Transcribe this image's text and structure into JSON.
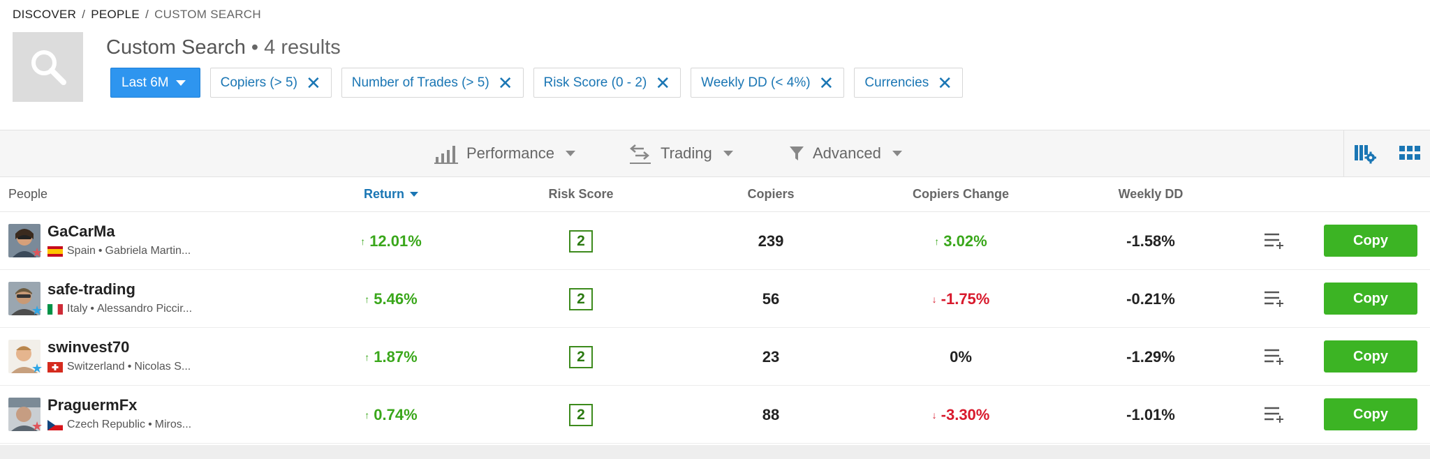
{
  "breadcrumb": {
    "items": [
      "DISCOVER",
      "PEOPLE",
      "CUSTOM SEARCH"
    ],
    "separator": "/"
  },
  "header": {
    "title": "Custom Search",
    "results": "• 4 results",
    "thumb_icon": "search-icon"
  },
  "filters": {
    "period": "Last 6M",
    "chips": [
      "Copiers (> 5)",
      "Number of Trades (> 5)",
      "Risk Score (0 - 2)",
      "Weekly DD (< 4%)",
      "Currencies"
    ],
    "remove_glyph": "✕"
  },
  "toolbar": {
    "performance": "Performance",
    "trading": "Trading",
    "advanced": "Advanced"
  },
  "table": {
    "columns": {
      "people": "People",
      "return": "Return",
      "risk": "Risk Score",
      "copiers": "Copiers",
      "change": "Copiers Change",
      "dd": "Weekly DD"
    },
    "rows": [
      {
        "username": "GaCarMa",
        "country": "Spain",
        "name": "Gabriela Martin...",
        "return": "12.01%",
        "return_dir": "up",
        "risk": "2",
        "copiers": "239",
        "change": "3.02%",
        "change_dir": "up",
        "weekly_dd": "-1.58%",
        "copy": "Copy",
        "star_color": "#e0545b"
      },
      {
        "username": "safe-trading",
        "country": "Italy",
        "name": "Alessandro Piccir...",
        "return": "5.46%",
        "return_dir": "up",
        "risk": "2",
        "copiers": "56",
        "change": "-1.75%",
        "change_dir": "down",
        "weekly_dd": "-0.21%",
        "copy": "Copy",
        "star_color": "#2ea6e6"
      },
      {
        "username": "swinvest70",
        "country": "Switzerland",
        "name": "Nicolas S...",
        "return": "1.87%",
        "return_dir": "up",
        "risk": "2",
        "copiers": "23",
        "change": "0%",
        "change_dir": "none",
        "weekly_dd": "-1.29%",
        "copy": "Copy",
        "star_color": "#2ea6e6"
      },
      {
        "username": "PraguermFx",
        "country": "Czech Republic",
        "name": "Miros...",
        "return": "0.74%",
        "return_dir": "up",
        "risk": "2",
        "copiers": "88",
        "change": "-3.30%",
        "change_dir": "down",
        "weekly_dd": "-1.01%",
        "copy": "Copy",
        "star_color": "#e0545b"
      }
    ]
  },
  "colors": {
    "accent": "#2e95ef",
    "link": "#1a76b4",
    "positive": "#3aa71b",
    "negative": "#d8192c",
    "copy_button": "#3cb424"
  }
}
